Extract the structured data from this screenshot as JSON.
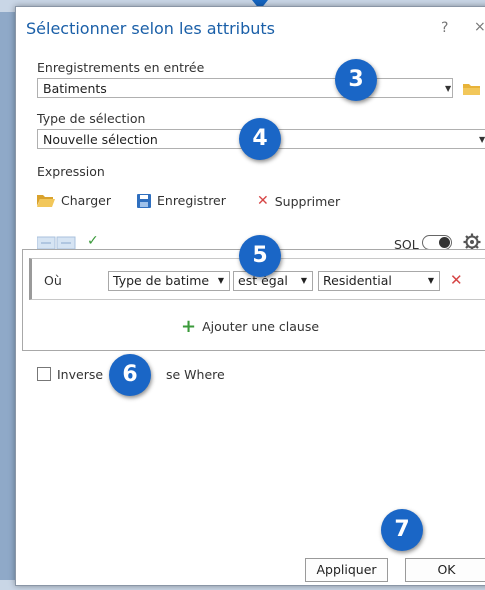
{
  "dialog": {
    "title": "Sélectionner selon les attributs",
    "help_label": "?",
    "close_label": "×"
  },
  "input_records": {
    "label": "Enregistrements en entrée",
    "value": "Batiments"
  },
  "selection_type": {
    "label": "Type de sélection",
    "value": "Nouvelle sélection"
  },
  "expression": {
    "label": "Expression",
    "load_label": "Charger",
    "save_label": "Enregistrer",
    "delete_label": "Supprimer",
    "sql_label": "SQL"
  },
  "clause": {
    "where_label": "Où",
    "field": "Type de batime",
    "operator": "est égal",
    "value": "Residential",
    "add_clause_label": "Ajouter une clause"
  },
  "invert": {
    "label_part1": "Inverse",
    "label_part2": "se Where"
  },
  "buttons": {
    "apply_label": "Appliquer",
    "ok_label": "OK"
  },
  "badges": [
    "3",
    "4",
    "5",
    "6",
    "7"
  ],
  "colors": {
    "accent": "#1a66c6",
    "title": "#1a5fa8",
    "folder": "#e8b339",
    "save_icon": "#2f6fbf",
    "delete_x": "#d64545",
    "check": "#3a9a3a",
    "add_plus": "#3a9a3a"
  }
}
